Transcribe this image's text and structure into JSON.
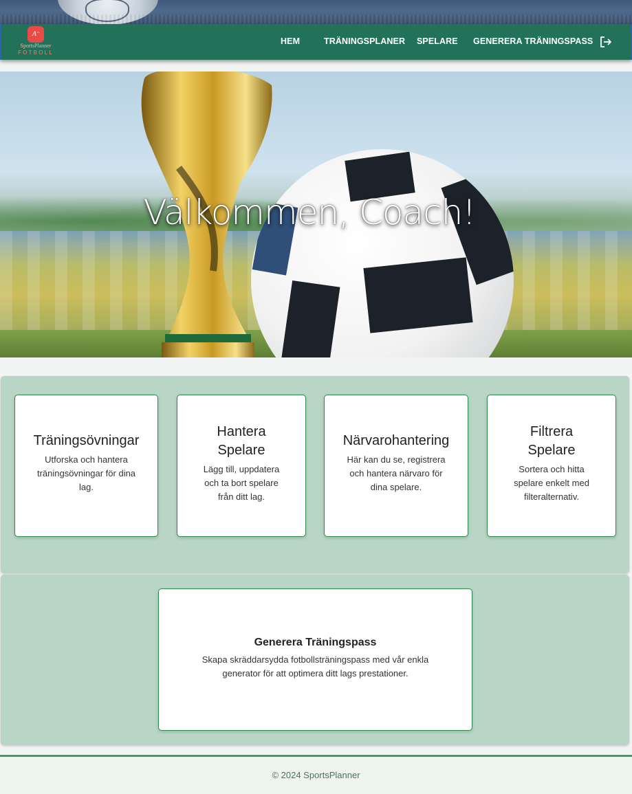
{
  "brand": {
    "logo_mark": "Aᵔ",
    "name": "SportsPlanner",
    "sub": "FOTBOLL"
  },
  "nav": {
    "items": [
      {
        "label": "HEM"
      },
      {
        "label": "TRÄNINGSPLANER"
      },
      {
        "label": "SPELARE"
      },
      {
        "label": "GENERERA TRÄNINGSPASS"
      }
    ],
    "logout_icon": "logout-icon"
  },
  "hero": {
    "title": "Välkommen, Coach!"
  },
  "features": [
    {
      "title": "Träningsövningar",
      "description": "Utforska och hantera träningsövningar för dina lag."
    },
    {
      "title": "Hantera Spelare",
      "description": "Lägg till, uppdatera och ta bort spelare från ditt lag."
    },
    {
      "title": "Närvarohantering",
      "description": "Här kan du se, registrera och hantera närvaro för dina spelare."
    },
    {
      "title": "Filtrera Spelare",
      "description": "Sortera och hitta spelare enkelt med filteralternativ."
    }
  ],
  "generator": {
    "title": "Generera Träningspass",
    "description": "Skapa skräddarsydda fotbollsträningspass med vår enkla generator för att optimera ditt lags prestationer."
  },
  "footer": {
    "text": "© 2024 SportsPlanner"
  },
  "colors": {
    "navbar": "#22725a",
    "panel": "#b8d5c5",
    "card_border": "#2e8a4a",
    "logo_red": "#e84b45"
  }
}
